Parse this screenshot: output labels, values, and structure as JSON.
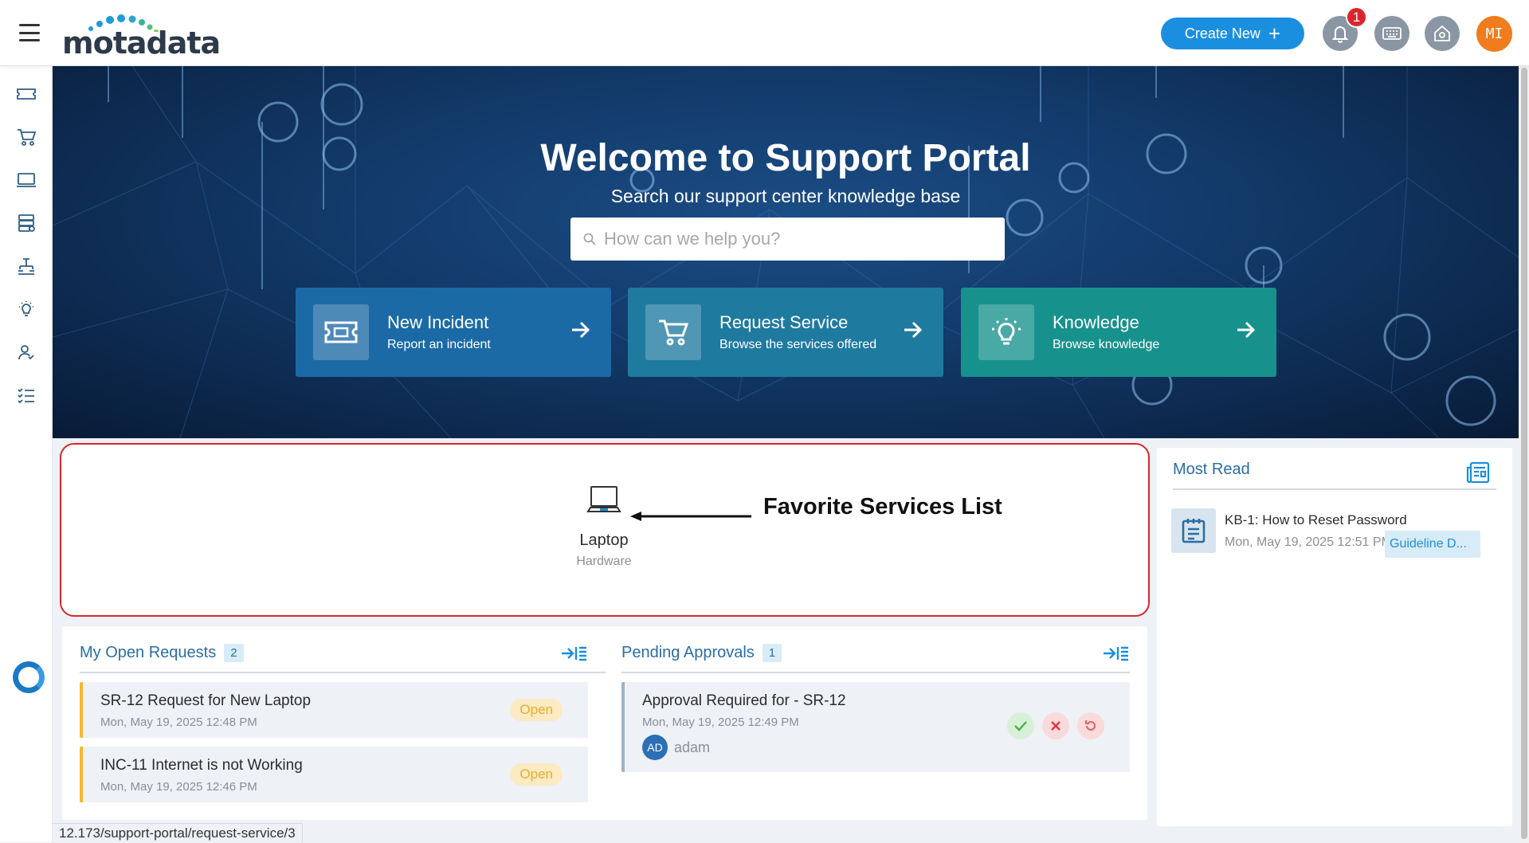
{
  "header": {
    "logo_text": "motadata",
    "create_new_label": "Create New",
    "notification_count": "1",
    "avatar_initials": "MI"
  },
  "sidebar": {
    "items": [
      {
        "icon": "ticket-icon"
      },
      {
        "icon": "cart-icon"
      },
      {
        "icon": "laptop-icon"
      },
      {
        "icon": "server-icon"
      },
      {
        "icon": "hierarchy-icon"
      },
      {
        "icon": "lightbulb-icon"
      },
      {
        "icon": "user-check-icon"
      },
      {
        "icon": "checklist-icon"
      }
    ]
  },
  "hero": {
    "title": "Welcome to Support Portal",
    "subtitle": "Search our support center knowledge base",
    "search_placeholder": "How can we help you?",
    "cards": [
      {
        "title": "New Incident",
        "subtitle": "Report an incident",
        "color": "#1b6aa5",
        "icon": "ticket-icon"
      },
      {
        "title": "Request Service",
        "subtitle": "Browse the services offered",
        "color": "#1f7aa0",
        "icon": "cart-icon"
      },
      {
        "title": "Knowledge",
        "subtitle": "Browse knowledge",
        "color": "#17918c",
        "icon": "lightbulb-icon"
      }
    ]
  },
  "favorites": {
    "items": [
      {
        "name": "Laptop",
        "category": "Hardware",
        "icon": "laptop-icon"
      }
    ],
    "annotation": "Favorite Services List"
  },
  "open_requests": {
    "title": "My Open Requests",
    "count": "2",
    "items": [
      {
        "title": "SR-12 Request for New Laptop",
        "date": "Mon, May 19, 2025 12:48 PM",
        "status": "Open"
      },
      {
        "title": "INC-11 Internet is not Working",
        "date": "Mon, May 19, 2025 12:46 PM",
        "status": "Open"
      }
    ]
  },
  "pending_approvals": {
    "title": "Pending Approvals",
    "count": "1",
    "items": [
      {
        "title": "Approval Required for - SR-12",
        "date": "Mon, May 19, 2025 12:49 PM",
        "user_initials": "AD",
        "user_name": "adam"
      }
    ]
  },
  "most_read": {
    "title": "Most Read",
    "items": [
      {
        "title": "KB-1: How to Reset Password",
        "date": "Mon, May 19, 2025 12:51 PM",
        "tag": "Guideline D..."
      }
    ]
  },
  "status_url": "12.173/support-portal/request-service/3",
  "colors": {
    "accent": "#1a8fe0",
    "heading_blue": "#2a6ea3",
    "open_status": "#e9ac2b",
    "annotation_border": "#d7262e",
    "avatar": "#f07c1e"
  }
}
